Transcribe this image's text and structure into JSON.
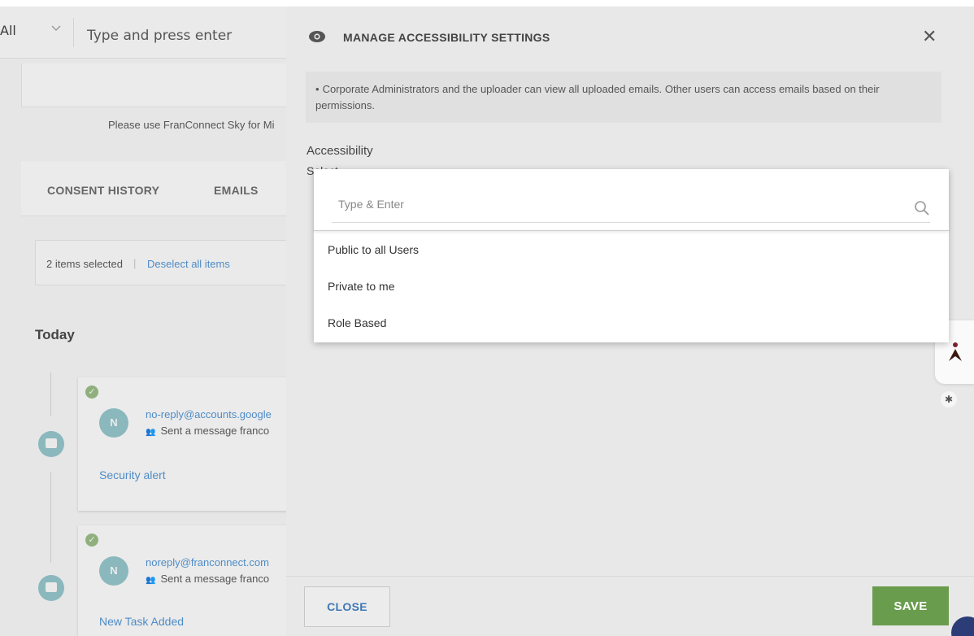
{
  "background": {
    "filter_value": "All",
    "search_placeholder": "Type and press enter",
    "note": "Please use FranConnect Sky for Mi",
    "tabs": [
      "CONSENT HISTORY",
      "EMAILS"
    ],
    "selection": {
      "count_text": "2 items selected",
      "separator": "|",
      "deselect_label": "Deselect all items"
    },
    "section_title": "Today",
    "entries": [
      {
        "avatar": "N",
        "from": "no-reply@accounts.google",
        "sent": "Sent a message franco",
        "subject": "Security alert"
      },
      {
        "avatar": "N",
        "from": "noreply@franconnect.com",
        "sent": "Sent a message franco",
        "subject": "New Task Added"
      }
    ]
  },
  "modal": {
    "title": "MANAGE ACCESSIBILITY SETTINGS",
    "close_glyph": "✕",
    "info_bullet": "•",
    "info_text": "Corporate Administrators and the uploader can view all uploaded emails. Other users can access emails based on their permissions.",
    "accessibility_label": "Accessibility",
    "select_placeholder": "Select",
    "footer": {
      "close_label": "CLOSE",
      "save_label": "SAVE"
    }
  },
  "dropdown": {
    "search_placeholder": "Type & Enter",
    "options": [
      "Public to all Users",
      "Private to me",
      "Role Based"
    ]
  },
  "colors": {
    "link": "#4e8cc7",
    "save_button": "#6a9c4e",
    "avatar": "#8ab8bd",
    "check": "#8fb07d"
  },
  "icons": [
    "eye-icon",
    "close-icon",
    "search-icon",
    "chevron-down-icon",
    "group-icon",
    "message-icon",
    "check-icon",
    "gear-icon",
    "assistant-icon"
  ]
}
